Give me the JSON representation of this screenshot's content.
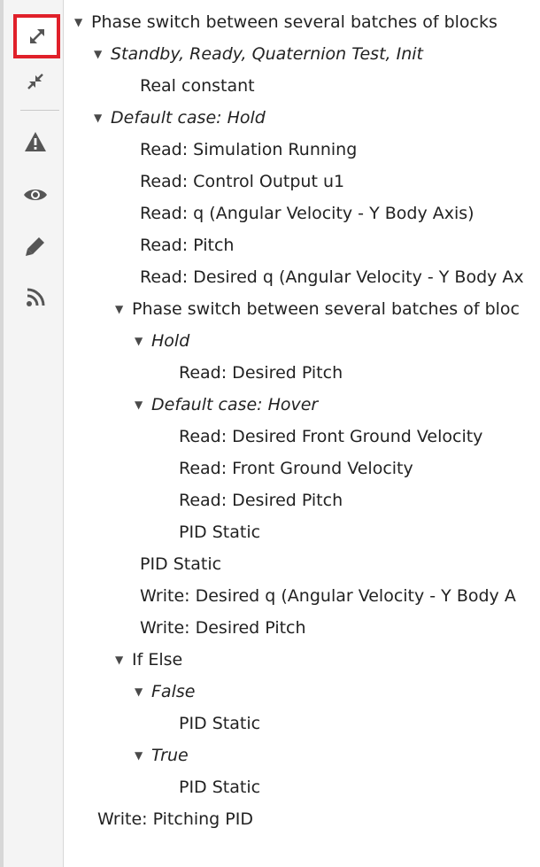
{
  "toolbar": {
    "buttons": [
      {
        "id": "expand-all",
        "icon": "expand-arrows-icon",
        "active": true
      },
      {
        "id": "collapse-all",
        "icon": "collapse-arrows-icon",
        "active": false
      },
      {
        "id": "warnings",
        "icon": "warning-triangle-icon",
        "active": false
      },
      {
        "id": "view",
        "icon": "eye-icon",
        "active": false
      },
      {
        "id": "edit",
        "icon": "pencil-icon",
        "active": false
      },
      {
        "id": "feed",
        "icon": "rss-feed-icon",
        "active": false
      }
    ],
    "active_border_color": "#e0202a",
    "icon_color": "#555555"
  },
  "tree": {
    "items": [
      {
        "label": "Phase switch between several batches of blocks",
        "level": 0,
        "expandable": true,
        "italic": false
      },
      {
        "label": "Standby, Ready, Quaternion Test, Init",
        "level": 1,
        "expandable": true,
        "italic": true
      },
      {
        "label": "Real constant",
        "level": 2,
        "expandable": false,
        "italic": false
      },
      {
        "label": "Default case: Hold",
        "level": 1,
        "expandable": true,
        "italic": true
      },
      {
        "label": "Read: Simulation Running",
        "level": 2,
        "expandable": false,
        "italic": false
      },
      {
        "label": "Read: Control Output u1",
        "level": 2,
        "expandable": false,
        "italic": false
      },
      {
        "label": "Read: q (Angular Velocity - Y Body Axis)",
        "level": 2,
        "expandable": false,
        "italic": false
      },
      {
        "label": "Read: Pitch",
        "level": 2,
        "expandable": false,
        "italic": false
      },
      {
        "label": "Read: Desired q (Angular Velocity - Y Body Ax",
        "level": 2,
        "expandable": false,
        "italic": false
      },
      {
        "label": "Phase switch between several batches of bloc",
        "level": 2,
        "expandable": true,
        "italic": false
      },
      {
        "label": "Hold",
        "level": 3,
        "expandable": true,
        "italic": true
      },
      {
        "label": "Read: Desired Pitch",
        "level": 4,
        "expandable": false,
        "italic": false
      },
      {
        "label": "Default case: Hover",
        "level": 3,
        "expandable": true,
        "italic": true
      },
      {
        "label": "Read: Desired Front Ground Velocity",
        "level": 4,
        "expandable": false,
        "italic": false
      },
      {
        "label": "Read: Front Ground Velocity",
        "level": 4,
        "expandable": false,
        "italic": false
      },
      {
        "label": "Read: Desired Pitch",
        "level": 4,
        "expandable": false,
        "italic": false
      },
      {
        "label": "PID Static",
        "level": 4,
        "expandable": false,
        "italic": false
      },
      {
        "label": "PID Static",
        "level": 2,
        "expandable": false,
        "italic": false
      },
      {
        "label": "Write: Desired q (Angular Velocity - Y Body A",
        "level": 2,
        "expandable": false,
        "italic": false
      },
      {
        "label": "Write: Desired Pitch",
        "level": 2,
        "expandable": false,
        "italic": false
      },
      {
        "label": "If Else",
        "level": 2,
        "expandable": true,
        "italic": false
      },
      {
        "label": "False",
        "level": 3,
        "expandable": true,
        "italic": true
      },
      {
        "label": "PID Static",
        "level": 4,
        "expandable": false,
        "italic": false
      },
      {
        "label": "True",
        "level": 3,
        "expandable": true,
        "italic": true
      },
      {
        "label": "PID Static",
        "level": 4,
        "expandable": false,
        "italic": false
      },
      {
        "label": "Write: Pitching PID",
        "level": 0,
        "expandable": false,
        "italic": false
      }
    ],
    "caret_glyph": "▼"
  }
}
